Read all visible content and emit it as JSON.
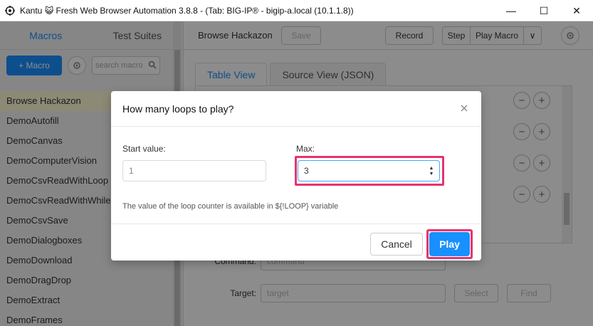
{
  "window": {
    "title": "Kantu 😺 Fresh Web Browser Automation 3.8.8 - (Tab: BIG-IP® - bigip-a.local (10.1.1.8))",
    "minimize": "—",
    "maximize": "☐",
    "close": "✕"
  },
  "sidebar": {
    "tabs": [
      {
        "label": "Macros"
      },
      {
        "label": "Test Suites"
      }
    ],
    "add_macro_label": "+ Macro",
    "search_placeholder": "search macro",
    "items": [
      {
        "label": "Browse Hackazon"
      },
      {
        "label": "DemoAutofill"
      },
      {
        "label": "DemoCanvas"
      },
      {
        "label": "DemoComputerVision"
      },
      {
        "label": "DemoCsvReadWithLoop"
      },
      {
        "label": "DemoCsvReadWithWhile"
      },
      {
        "label": "DemoCsvSave"
      },
      {
        "label": "DemoDialogboxes"
      },
      {
        "label": "DemoDownload"
      },
      {
        "label": "DemoDragDrop"
      },
      {
        "label": "DemoExtract"
      },
      {
        "label": "DemoFrames"
      }
    ]
  },
  "toolbar": {
    "macro_name": "Browse Hackazon",
    "save_label": "Save",
    "record_label": "Record",
    "step_label": "Step",
    "play_macro_label": "Play Macro",
    "dropdown_icon": "∨"
  },
  "view_tabs": [
    {
      "label": "Table View"
    },
    {
      "label": "Source View (JSON)"
    }
  ],
  "command_form": {
    "command_label": "Command:",
    "command_placeholder": "command",
    "target_label": "Target:",
    "target_placeholder": "target",
    "select_label": "Select",
    "find_label": "Find"
  },
  "dialog": {
    "title": "How many loops to play?",
    "start_label": "Start value:",
    "start_value": "1",
    "max_label": "Max:",
    "max_value": "3",
    "note": "The value of the loop counter is available in ${!LOOP} variable",
    "cancel_label": "Cancel",
    "play_label": "Play"
  },
  "colors": {
    "accent": "#1890ff",
    "highlight": "#e8336d"
  }
}
